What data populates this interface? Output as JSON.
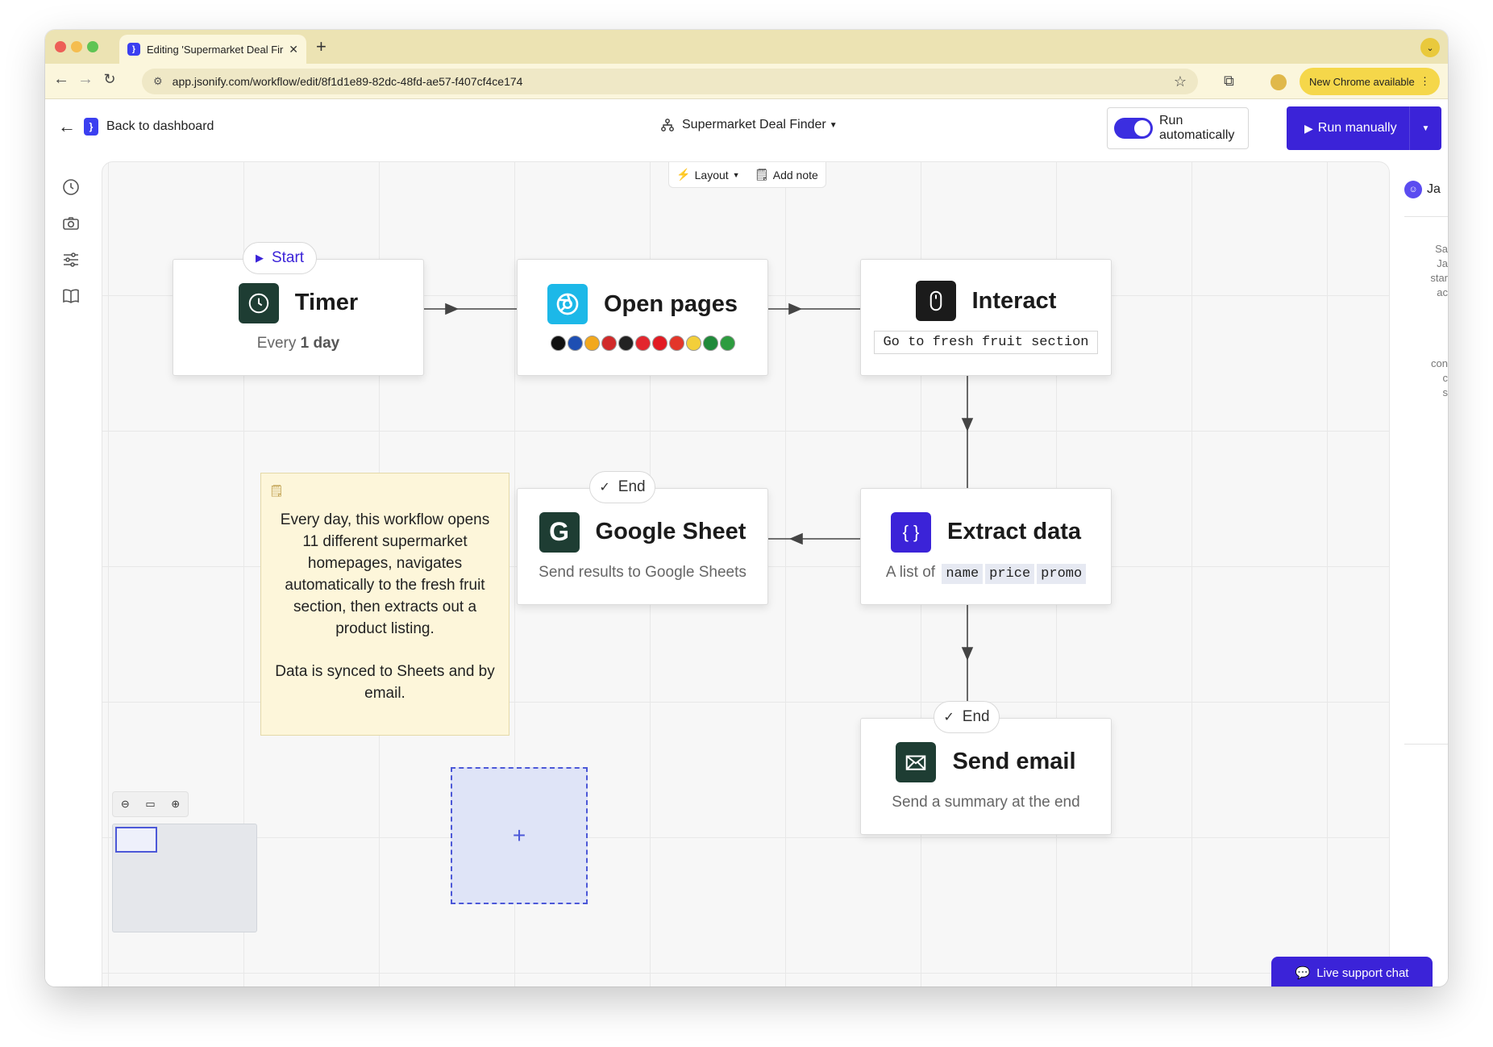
{
  "browser": {
    "tab_title": "Editing 'Supermarket Deal Fir",
    "url": "app.jsonify.com/workflow/edit/8f1d1e89-82dc-48fd-ae57-f407cf4ce174",
    "new_chrome_label": "New Chrome available"
  },
  "header": {
    "back_label": "Back to dashboard",
    "workflow_name": "Supermarket Deal Finder",
    "run_auto_label": "Run automatically",
    "run_auto_on": true,
    "run_manual_label": "Run manually"
  },
  "canvas_tools": {
    "layout_label": "Layout",
    "add_note_label": "Add note"
  },
  "nodes": {
    "timer": {
      "title": "Timer",
      "sub_prefix": "Every ",
      "sub_bold": "1 day",
      "pill": "Start"
    },
    "open_pages": {
      "title": "Open pages",
      "site_logo_count": 11
    },
    "interact": {
      "title": "Interact",
      "instruction": "Go to fresh fruit section"
    },
    "extract": {
      "title": "Extract data",
      "sub_prefix": "A list of",
      "fields": [
        "name",
        "price",
        "promo"
      ]
    },
    "google_sheet": {
      "title": "Google Sheet",
      "sub": "Send results to Google Sheets",
      "pill": "End"
    },
    "send_email": {
      "title": "Send email",
      "sub": "Send a summary at the end",
      "pill": "End"
    }
  },
  "note": {
    "paragraph_1": "Every day, this workflow opens 11 different supermarket homepages, navigates automatically to the fresh fruit section, then extracts out a product listing.",
    "paragraph_2": "Data is synced to Sheets and by email."
  },
  "right_panel": {
    "name": "Ja",
    "text_lines_1": [
      "Sa",
      "Ja",
      "star",
      "ac"
    ],
    "text_lines_2": [
      "con",
      "c",
      "s"
    ]
  },
  "live_chat_label": "Live support chat",
  "colors": {
    "accent": "#3b23d8",
    "tabbar": "#ece3b3",
    "node_dark": "#1e3d33",
    "sky": "#1cb8e8",
    "note_bg": "#fdf6da"
  }
}
